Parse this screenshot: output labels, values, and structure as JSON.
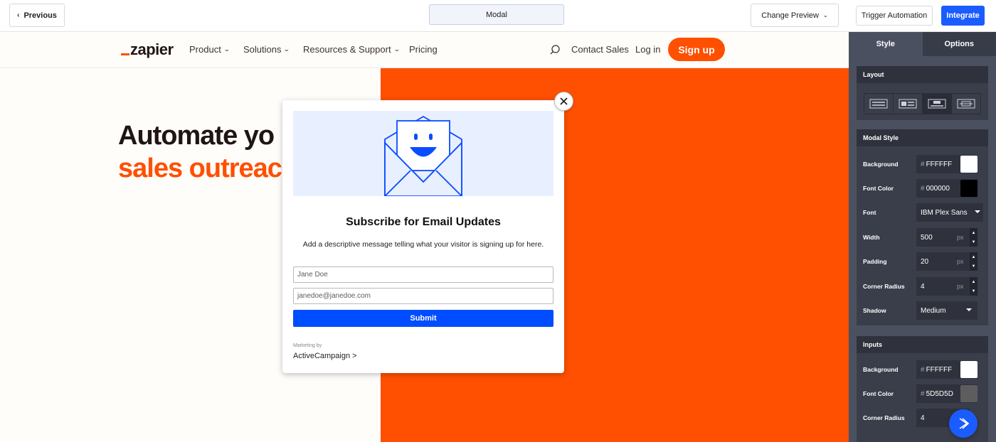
{
  "toolbar": {
    "previous_label": "Previous",
    "modal_label": "Modal",
    "change_preview_label": "Change Preview",
    "trigger_label": "Trigger Automation",
    "integrate_label": "Integrate"
  },
  "site": {
    "logo": "zapier",
    "nav": [
      "Product",
      "Solutions",
      "Resources & Support",
      "Pricing"
    ],
    "contact": "Contact Sales",
    "login": "Log in",
    "signup": "Sign up",
    "hero_line1": "Automate yo",
    "hero_line2": "sales outreac"
  },
  "modal": {
    "title": "Subscribe for Email Updates",
    "description": "Add a descriptive message telling what your visitor is signing up for here.",
    "name_value": "Jane Doe",
    "email_value": "janedoe@janedoe.com",
    "submit_label": "Submit",
    "marketing_by": "Marketing by",
    "brand": "ActiveCampaign >"
  },
  "panel": {
    "tabs": [
      "Style",
      "Options"
    ],
    "layout_title": "Layout",
    "modal_style_title": "Modal Style",
    "inputs_title": "Inputs",
    "modal_style": {
      "background_label": "Background",
      "background_value": "FFFFFF",
      "font_color_label": "Font Color",
      "font_color_value": "000000",
      "font_label": "Font",
      "font_value": "IBM Plex Sans",
      "width_label": "Width",
      "width_value": "500",
      "padding_label": "Padding",
      "padding_value": "20",
      "radius_label": "Corner Radius",
      "radius_value": "4",
      "shadow_label": "Shadow",
      "shadow_value": "Medium",
      "unit": "px",
      "hash": "#"
    },
    "inputs": {
      "background_label": "Background",
      "background_value": "FFFFFF",
      "font_color_label": "Font Color",
      "font_color_value": "5D5D5D",
      "radius_label": "Corner Radius",
      "radius_value": "4"
    }
  },
  "colors": {
    "accent": "#1a5cff",
    "zapier_orange": "#ff4f00",
    "submit_blue": "#004cff"
  }
}
